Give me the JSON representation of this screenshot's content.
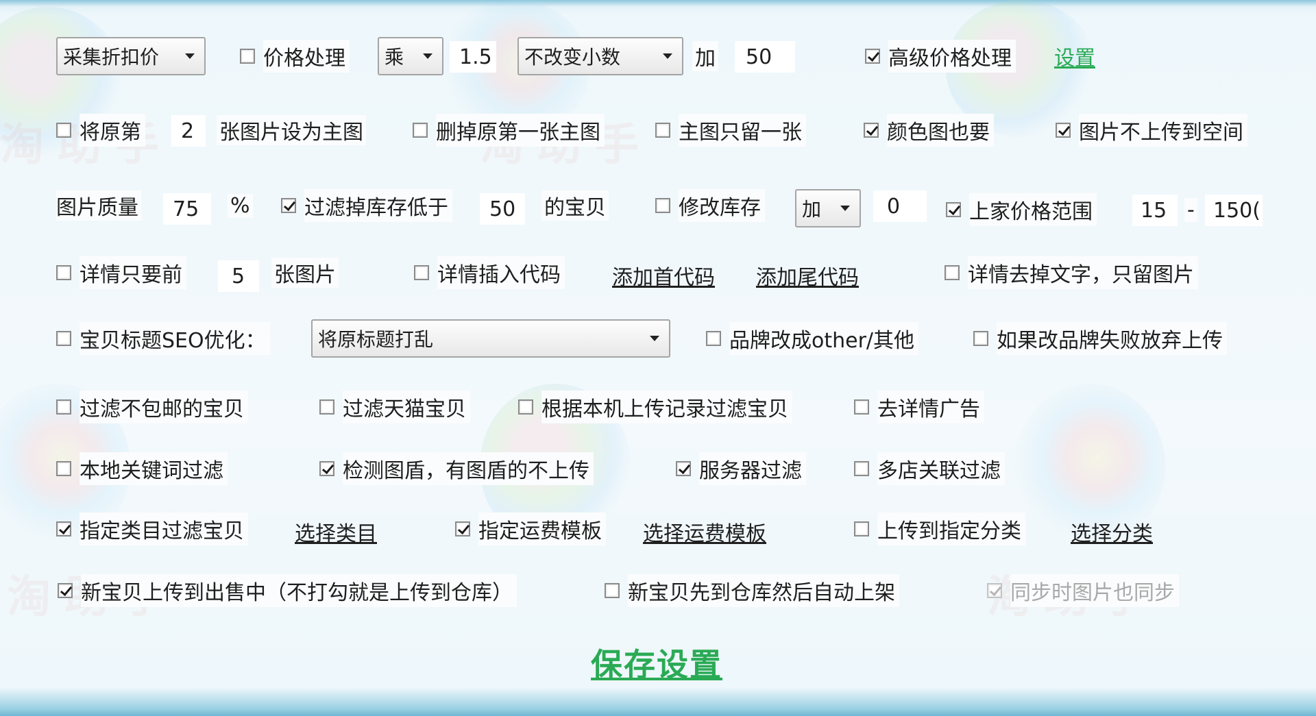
{
  "row1": {
    "price_source": "采集折扣价",
    "price_process_label": "价格处理",
    "price_process_checked": false,
    "operator": "乘",
    "multiplier": "1.5",
    "decimal_mode": "不改变小数",
    "add_label": "加",
    "add_value": "50",
    "advanced_price_label": "高级价格处理",
    "advanced_price_checked": true,
    "settings_link": "设置"
  },
  "row2": {
    "main_image_prefix": "将原第",
    "main_image_index": "2",
    "main_image_suffix": "张图片设为主图",
    "main_image_checked": false,
    "delete_first_label": "删掉原第一张主图",
    "delete_first_checked": false,
    "keep_one_label": "主图只留一张",
    "keep_one_checked": false,
    "color_images_label": "颜色图也要",
    "color_images_checked": true,
    "no_upload_space_label": "图片不上传到空间",
    "no_upload_space_checked": true
  },
  "row3": {
    "quality_label": "图片质量",
    "quality_value": "75",
    "percent_sign": "%",
    "filter_stock_label": "过滤掉库存低于",
    "filter_stock_checked": true,
    "stock_threshold": "50",
    "filter_stock_suffix": "的宝贝",
    "modify_stock_label": "修改库存",
    "modify_stock_checked": false,
    "stock_operator": "加",
    "stock_delta": "0",
    "price_range_label": "上家价格范围",
    "price_range_checked": true,
    "price_min": "15",
    "range_dash": "-",
    "price_max": "150("
  },
  "row4": {
    "detail_first_label": "详情只要前",
    "detail_first_checked": false,
    "detail_count": "5",
    "detail_first_suffix": "张图片",
    "insert_code_label": "详情插入代码",
    "insert_code_checked": false,
    "add_head_code": "添加首代码",
    "add_tail_code": "添加尾代码",
    "remove_text_label": "详情去掉文字，只留图片",
    "remove_text_checked": false
  },
  "row5": {
    "seo_label": "宝贝标题SEO优化：",
    "seo_checked": false,
    "seo_mode": "将原标题打乱",
    "brand_other_label": "品牌改成other/其他",
    "brand_other_checked": false,
    "brand_fail_label": "如果改品牌失败放弃上传",
    "brand_fail_checked": false
  },
  "row6": {
    "no_free_ship_label": "过滤不包邮的宝贝",
    "no_free_ship_checked": false,
    "filter_tmall_label": "过滤天猫宝贝",
    "filter_tmall_checked": false,
    "filter_history_label": "根据本机上传记录过滤宝贝",
    "filter_history_checked": false,
    "remove_ads_label": "去详情广告",
    "remove_ads_checked": false
  },
  "row7": {
    "local_keyword_label": "本地关键词过滤",
    "local_keyword_checked": false,
    "shield_label": "检测图盾，有图盾的不上传",
    "shield_checked": true,
    "server_filter_label": "服务器过滤",
    "server_filter_checked": true,
    "multi_shop_label": "多店关联过滤",
    "multi_shop_checked": false
  },
  "row8": {
    "category_filter_label": "指定类目过滤宝贝",
    "category_filter_checked": true,
    "choose_category": "选择类目",
    "shipping_template_label": "指定运费模板",
    "shipping_template_checked": true,
    "choose_shipping": "选择运费模板",
    "upload_category_label": "上传到指定分类",
    "upload_category_checked": false,
    "choose_class": "选择分类"
  },
  "row9": {
    "on_sale_label": "新宝贝上传到出售中（不打勾就是上传到仓库）",
    "on_sale_checked": true,
    "warehouse_auto_label": "新宝贝先到仓库然后自动上架",
    "warehouse_auto_checked": false,
    "sync_images_label": "同步时图片也同步",
    "sync_images_checked": true
  },
  "save_button": "保存设置",
  "watermark_text": "淘助手"
}
